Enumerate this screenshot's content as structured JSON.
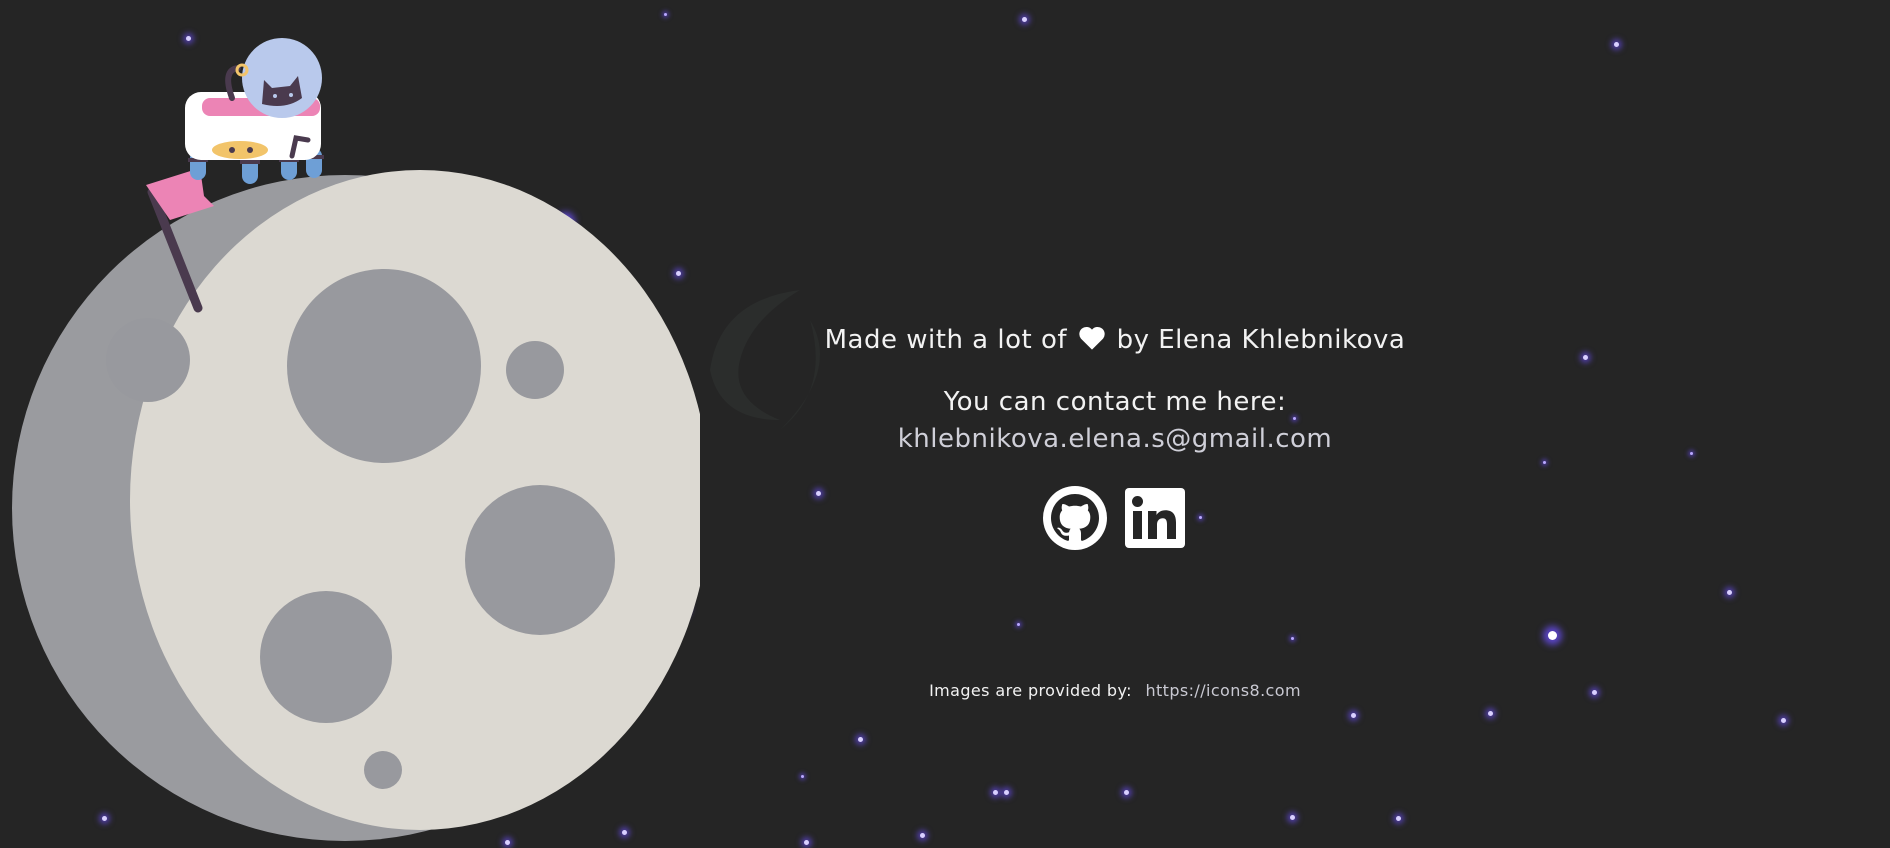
{
  "footer": {
    "made_prefix": "Made with a lot of",
    "heart_icon": "heart-icon",
    "made_suffix": "by Elena Khlebnikova",
    "contact_title": "You can contact me here:",
    "email": "khlebnikova.elena.s@gmail.com",
    "social_links": [
      {
        "name": "github",
        "icon": "github-icon"
      },
      {
        "name": "linkedin",
        "icon": "linkedin-icon"
      }
    ],
    "credits_label": "Images are provided by:",
    "credits_link": "https://icons8.com"
  },
  "colors": {
    "background": "#252525",
    "moon_light": "#dcd9d2",
    "moon_shadow": "#9a9b9f",
    "crater": "#98999e",
    "star_glow": "#6e50ff",
    "text": "#f2f2f2"
  }
}
